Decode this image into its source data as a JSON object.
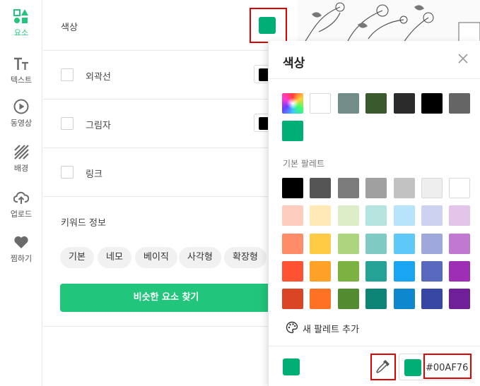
{
  "nav": {
    "items": [
      {
        "label": "요소",
        "icon": "elements-icon"
      },
      {
        "label": "텍스트",
        "icon": "text-icon"
      },
      {
        "label": "동영상",
        "icon": "video-icon"
      },
      {
        "label": "배경",
        "icon": "background-icon"
      },
      {
        "label": "업로드",
        "icon": "upload-icon"
      },
      {
        "label": "찜하기",
        "icon": "heart-icon"
      }
    ],
    "active_color": "#21c57b"
  },
  "panel": {
    "color_label": "색상",
    "current_color": "#00AF76",
    "outline_label": "외곽선",
    "shadow_label": "그림자",
    "link_label": "링크",
    "keyword_title": "키워드 정보",
    "keywords": [
      "기본",
      "네모",
      "베이직",
      "사각형",
      "확장형"
    ],
    "find_button": "비슷한 요소 찾기",
    "accent_color": "#21c57b"
  },
  "popover": {
    "title": "색상",
    "recent_colors": [
      "rainbow",
      "#FFFFFF",
      "#728D87",
      "#3A5A2E",
      "#2B2B2B",
      "#000000",
      "#656565",
      "#00AF76"
    ],
    "palette_title": "기본 팔레트",
    "palette_rows": [
      [
        "#000000",
        "#555555",
        "#7B7B7B",
        "#A0A0A0",
        "#C2C2C2",
        "#EEEEEE",
        "#FFFFFF"
      ],
      [
        "#FFCCC0",
        "#FFEAB7",
        "#DDEDC8",
        "#B5E4DF",
        "#B7E3FB",
        "#CED2F1",
        "#E4C5EA"
      ],
      [
        "#FF8C69",
        "#FFCB45",
        "#ADD47F",
        "#7FCBC4",
        "#5EC8F8",
        "#9EA8DA",
        "#C178D0"
      ],
      [
        "#FF5233",
        "#FFA227",
        "#7BB242",
        "#25A296",
        "#1AA5F2",
        "#5969BE",
        "#9E2EB5"
      ],
      [
        "#DA4625",
        "#FF7223",
        "#538B31",
        "#0D8576",
        "#0F87CF",
        "#3747A3",
        "#6F2099"
      ]
    ],
    "add_palette": "새 팔레트 추가",
    "hex_value": "#00AF76"
  }
}
